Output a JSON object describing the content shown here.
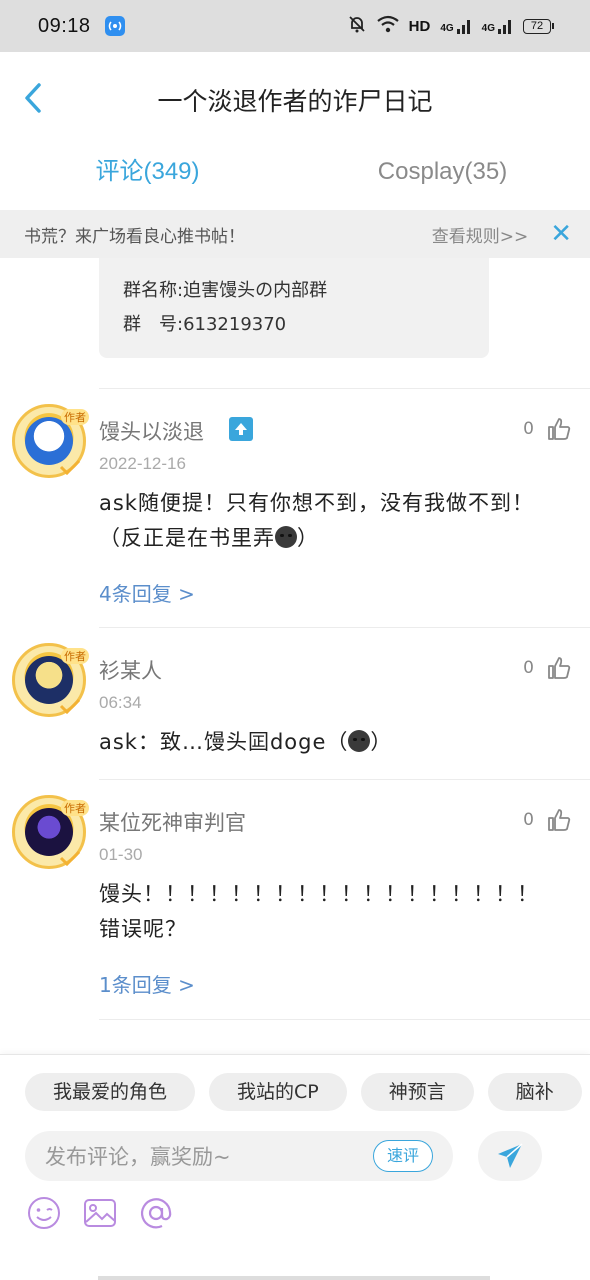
{
  "status_bar": {
    "time": "09:18",
    "network_label": "HD",
    "signal1_label": "4G",
    "signal2_label": "4G",
    "battery": "72"
  },
  "header": {
    "title": "一个淡退作者的诈尸日记",
    "accent_color": "#3aa6dc"
  },
  "tabs": [
    {
      "label": "评论(349)",
      "active": true
    },
    {
      "label": "Cosplay(35)",
      "active": false
    }
  ],
  "banner": {
    "text": "书荒？来广场看良心推书帖！",
    "rules_link": "查看规则>>",
    "close_icon": "close-icon"
  },
  "quote_card": {
    "line1": "群名称:迫害馒头の内部群",
    "line2": "群　号:613219370"
  },
  "comments": [
    {
      "username": "馒头以淡退",
      "date": "2022-12-16",
      "likes": "0",
      "content_before_emoji": "ask随便提！只有你想不到，没有我做不到！（反正是在书里弄",
      "content_after_emoji": "）",
      "replies": "4条回复 >",
      "author_tag": "作者"
    },
    {
      "username": "衫某人",
      "date": "06:34",
      "likes": "0",
      "content_before_emoji": "ask：致…馒头囸doge（",
      "content_after_emoji": "）",
      "replies": "",
      "author_tag": "作者"
    },
    {
      "username": "某位死神审判官",
      "date": "01-30",
      "likes": "0",
      "content_before_emoji": "馒头！！！！！！！！！！！！！！！！！！错误呢？",
      "content_after_emoji": "",
      "replies": "1条回复 >",
      "author_tag": "作者"
    }
  ],
  "bottom": {
    "chips": [
      "我最爱的角色",
      "我站的CP",
      "神预言",
      "脑补"
    ],
    "input_placeholder": "发布评论，赢奖励~",
    "quick_label": "速评",
    "tools": [
      "emoji-icon",
      "image-icon",
      "mention-icon"
    ]
  }
}
